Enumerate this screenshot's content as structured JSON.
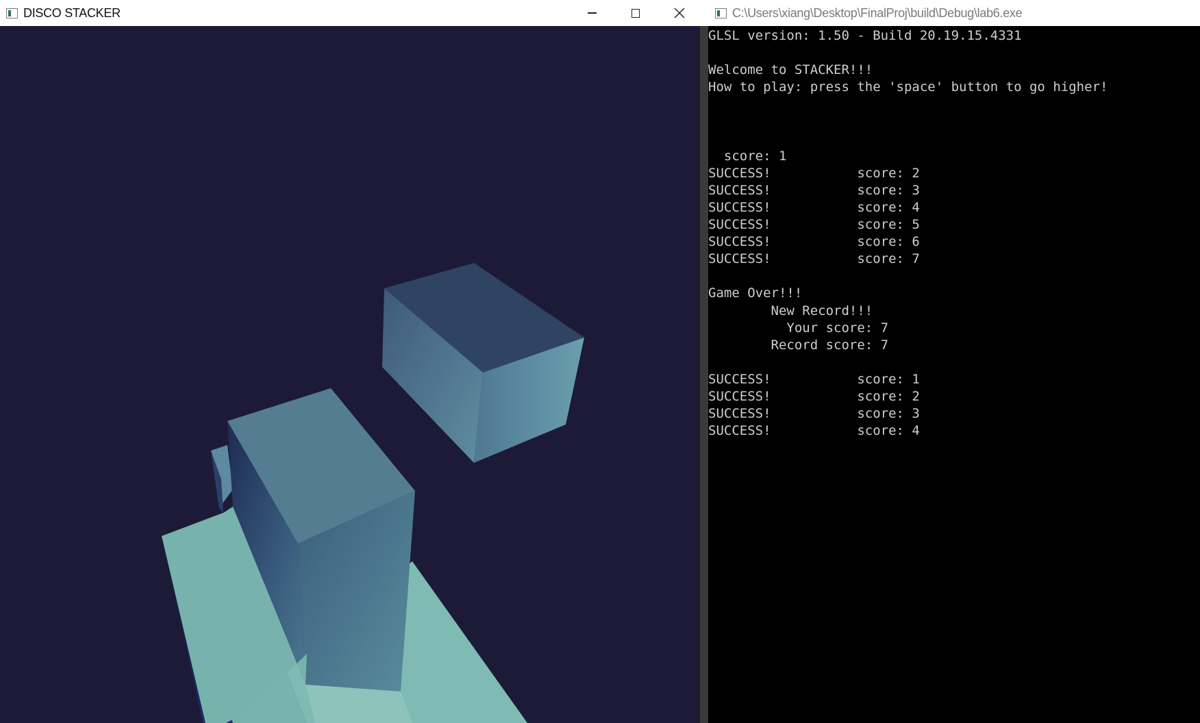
{
  "game_window": {
    "title": "DISCO STACKER",
    "controls": {
      "minimize": "minimize",
      "maximize": "maximize",
      "close": "close"
    },
    "background_color": "#1c1a37",
    "block_colors": {
      "light_face": "#7fb9b4",
      "mid_face": "#4d7391",
      "dark_face": "#1f2c57",
      "top_face": "#2f4562"
    }
  },
  "console_window": {
    "title": "C:\\Users\\xiang\\Desktop\\FinalProj\\build\\Debug\\lab6.exe",
    "lines": [
      "GLSL version: 1.50 - Build 20.19.15.4331",
      "",
      "Welcome to STACKER!!!",
      "How to play: press the 'space' button to go higher!",
      "",
      "",
      "",
      "  score: 1",
      "SUCCESS!           score: 2",
      "SUCCESS!           score: 3",
      "SUCCESS!           score: 4",
      "SUCCESS!           score: 5",
      "SUCCESS!           score: 6",
      "SUCCESS!           score: 7",
      "",
      "Game Over!!!",
      "        New Record!!!",
      "          Your score: 7",
      "        Record score: 7",
      "",
      "SUCCESS!           score: 1",
      "SUCCESS!           score: 2",
      "SUCCESS!           score: 3",
      "SUCCESS!           score: 4"
    ]
  }
}
